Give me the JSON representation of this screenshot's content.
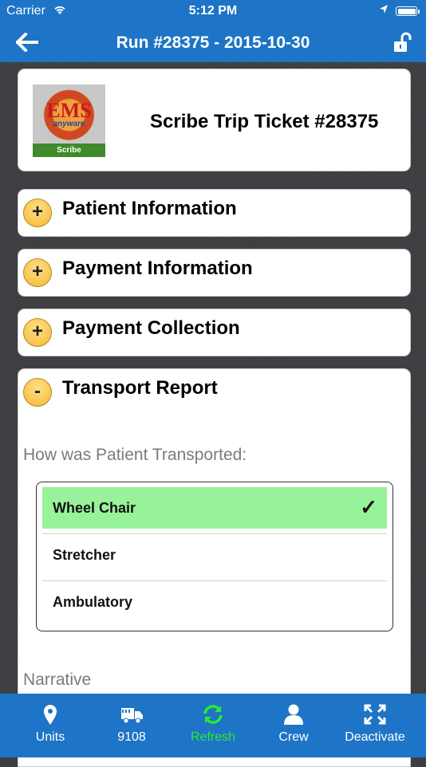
{
  "status_bar": {
    "carrier": "Carrier",
    "time": "5:12 PM"
  },
  "nav": {
    "title": "Run #28375 - 2015-10-30",
    "back_icon": "back-arrow-icon",
    "lock_icon": "unlock-icon"
  },
  "header": {
    "title": "Scribe Trip Ticket #28375",
    "logo_text": "EMS Anyware Scribe"
  },
  "sections": [
    {
      "label": "Patient Information",
      "toggle": "+"
    },
    {
      "label": "Payment Information",
      "toggle": "+"
    },
    {
      "label": "Payment Collection",
      "toggle": "+"
    },
    {
      "label": "Transport Report",
      "toggle": "-"
    }
  ],
  "transport": {
    "question": "How was Patient Transported:",
    "options": [
      "Wheel Chair",
      "Stretcher",
      "Ambulatory"
    ],
    "selected": "Wheel Chair",
    "narrative_label": "Narrative"
  },
  "tabs": [
    {
      "label": "Units",
      "icon": "map-pin-icon"
    },
    {
      "label": "9108",
      "icon": "truck-icon"
    },
    {
      "label": "Refresh",
      "icon": "refresh-icon"
    },
    {
      "label": "Crew",
      "icon": "person-icon"
    },
    {
      "label": "Deactivate",
      "icon": "expand-icon"
    }
  ],
  "colors": {
    "brand_blue": "#1e74c6",
    "selected_green": "#98f29a",
    "refresh_green": "#2ee82e",
    "toggle_yellow": "#f4b830"
  }
}
